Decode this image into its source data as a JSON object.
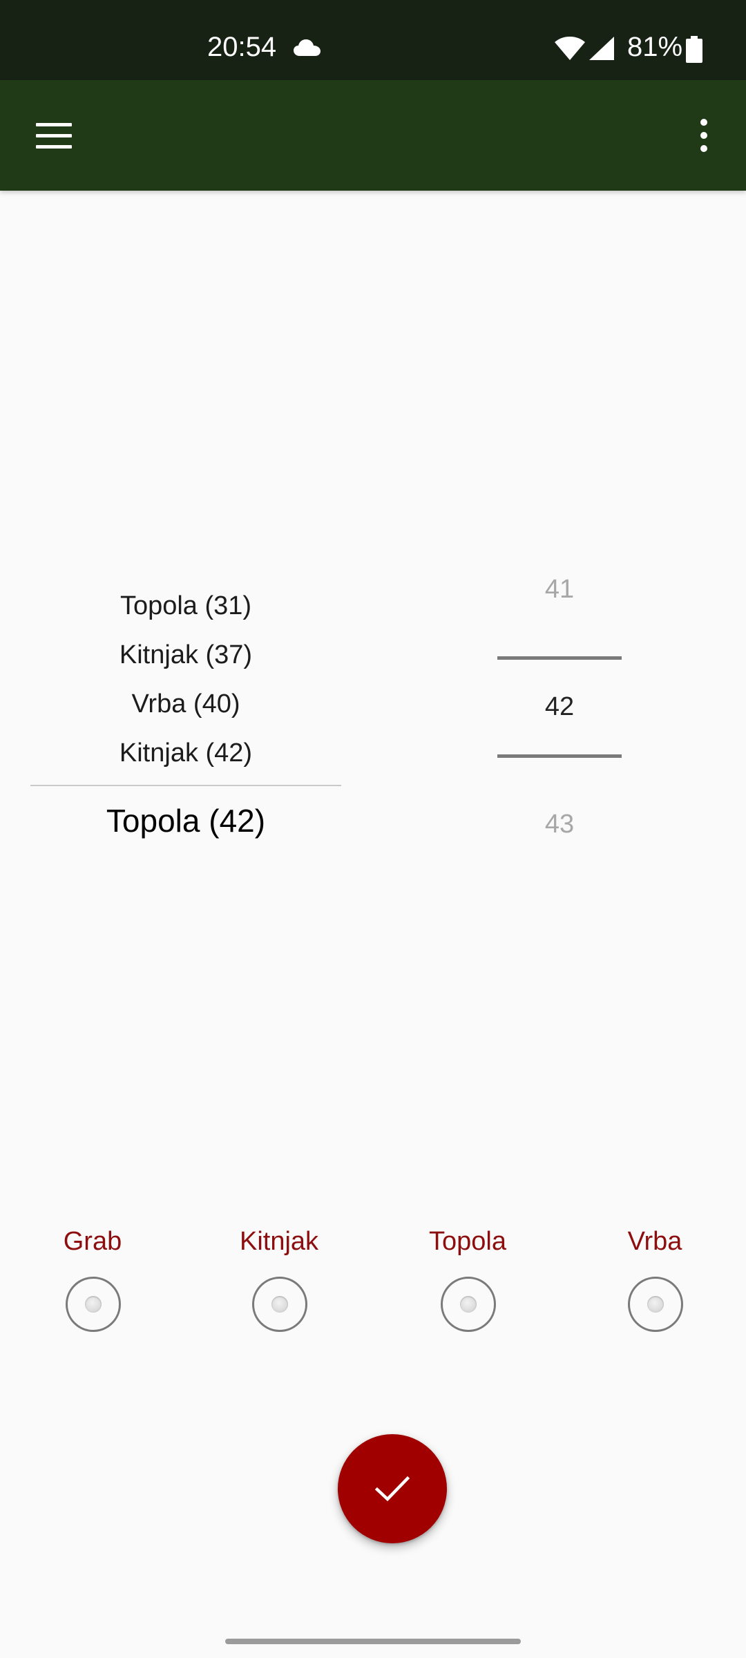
{
  "status_bar": {
    "time": "20:54",
    "battery": "81%",
    "icons": [
      "cloud-icon",
      "wifi-icon",
      "signal-icon",
      "battery-icon"
    ]
  },
  "app_bar": {
    "icons": [
      "menu-icon",
      "more-vert-icon"
    ],
    "background_color": "#203a18"
  },
  "list_picker": {
    "items": [
      "Topola (31)",
      "Kitnjak (37)",
      "Vrba (40)",
      "Kitnjak (42)"
    ],
    "selected": "Topola (42)"
  },
  "number_picker": {
    "previous": "41",
    "current": "42",
    "next": "43"
  },
  "radio_group": {
    "options": [
      "Grab",
      "Kitnjak",
      "Topola",
      "Vrba"
    ],
    "label_color": "#8d0e0e"
  },
  "fab": {
    "icon": "check-icon",
    "color": "#a00000"
  }
}
